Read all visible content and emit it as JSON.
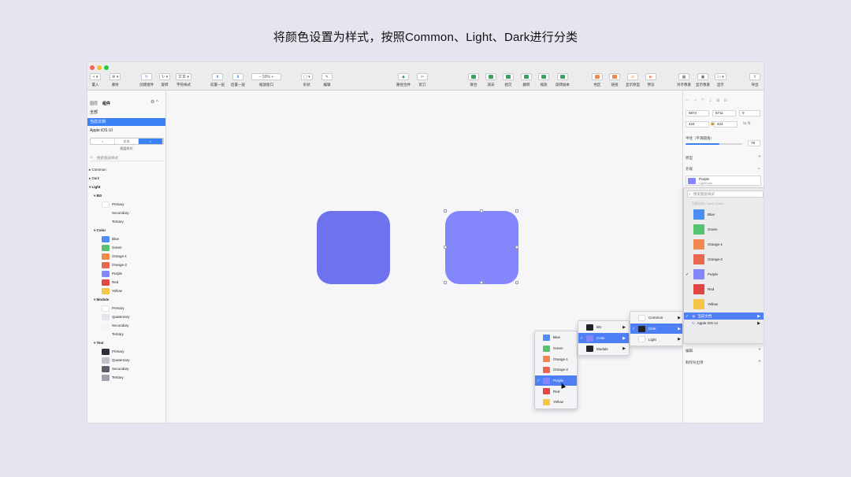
{
  "caption": "将颜色设置为样式，按照Common、Light、Dark进行分类",
  "colors": {
    "accent": "#3b82f6",
    "blue": "#4d8ef5",
    "green": "#56c36f",
    "orange1": "#f0894f",
    "orange2": "#e9664f",
    "purple": "#8387fb",
    "purple_dark": "#6e72ec",
    "red": "#e14642",
    "yellow": "#f5c547",
    "dark": "#23232a"
  },
  "toolbar": {
    "insert": "置入",
    "material": "素材",
    "create_component": "创建组件",
    "rotate": "旋转",
    "char_style": "字符样式",
    "bring_forward": "前置一层",
    "send_backward": "后置一层",
    "zoom_value": "50%",
    "zoom_label": "缩放窗口",
    "shape": "形状",
    "edit": "编辑",
    "merge": "路径合并",
    "cut": "剪刀",
    "union": "联合",
    "subtract": "减去",
    "intersect": "相交",
    "difference": "差集",
    "mask": "蒙版",
    "flip": "翻转",
    "scale": "缩放",
    "rotate_copy": "旋转副本",
    "color": "色区",
    "link": "链接",
    "show_prototype": "显示原型",
    "preview": "预览",
    "align": "对齐像素",
    "show_grid": "显示像素",
    "display": "显示",
    "export": "导出"
  },
  "left_panel": {
    "tab1": "图层",
    "tab2": "组件",
    "all": "全部",
    "current_doc": "当前文档",
    "apple_ios": "Apple iOS UI",
    "seg_left": "○",
    "seg_mid": "文本",
    "seg_right": "◐",
    "seg_caption": "图层样式",
    "search_placeholder": "搜索图层样式",
    "tree": {
      "common": "Common",
      "dark": "Dark",
      "light": "Light",
      "bg": "BG",
      "bg_items": [
        "Primary",
        "Secondary",
        "Tertiary"
      ],
      "color": "Color",
      "color_items": [
        "Blue",
        "Green",
        "Orange-1",
        "Orange-2",
        "Purple",
        "Red",
        "Yellow"
      ],
      "module": "Module",
      "module_items": [
        "Primary",
        "Quaternary",
        "Secondary",
        "Tertiary"
      ],
      "text": "Text",
      "text_items": [
        "Primary",
        "Quaternary",
        "Secondary",
        "Tertiary"
      ]
    }
  },
  "right_panel": {
    "x": "5874",
    "y": "6711",
    "rot": "0",
    "w": "424",
    "h": "424",
    "radius_label": "半径（平滑圆角）",
    "radius_value": "79",
    "prototype_label": "原型",
    "appearance_label": "外观",
    "style_name": "Purple",
    "style_sub": "Light/Color",
    "search_placeholder": "搜索图层样式",
    "breadcrumb": "当前文档 / Dark / Color",
    "swatches": [
      "Blue",
      "Green",
      "Orange-1",
      "Orange-2",
      "Purple",
      "Red",
      "Yellow"
    ],
    "lib_current": "当前文档",
    "lib_apple": "Apple iOS UI",
    "fill_label": "编辑",
    "export_label": "制作导出项"
  },
  "menus": {
    "level1": [
      "Common",
      "Dark",
      "Light"
    ],
    "level2": [
      "BG",
      "Color",
      "Module"
    ],
    "level3": [
      "Blue",
      "Green",
      "Orange-1",
      "Orange-2",
      "Purple",
      "Red",
      "Yellow"
    ]
  }
}
